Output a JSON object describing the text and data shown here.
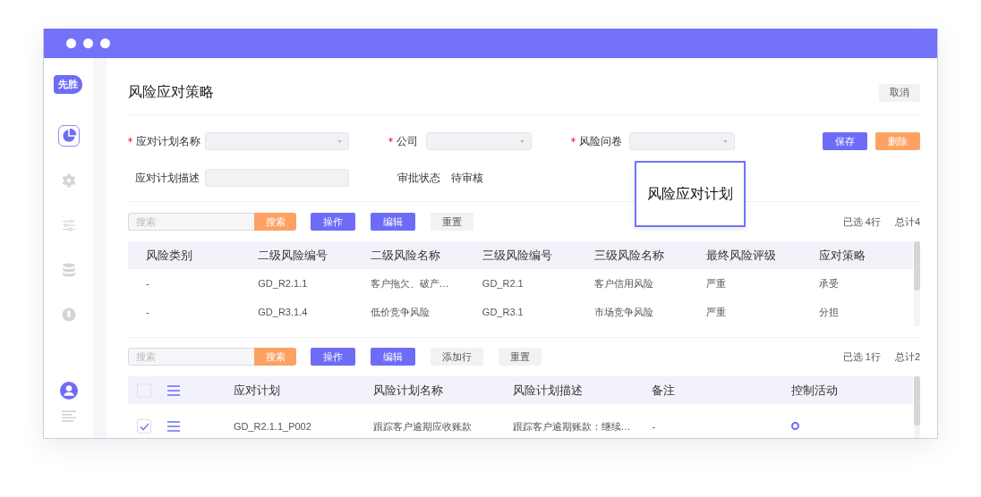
{
  "sidebar": {
    "logo": "先胜",
    "items": [
      {
        "kind": "chart",
        "selected": true
      },
      {
        "kind": "settings",
        "selected": false
      },
      {
        "kind": "sliders",
        "selected": false
      },
      {
        "kind": "database",
        "selected": false
      },
      {
        "kind": "bulb",
        "selected": false
      }
    ],
    "footer_items": [
      {
        "kind": "user"
      },
      {
        "kind": "list"
      }
    ]
  },
  "page": {
    "title": "风险应对策略",
    "cancel_button": "取消"
  },
  "form": {
    "fields": [
      {
        "label": "应对计划名称",
        "required": true,
        "kind": "select"
      },
      {
        "label": "公司",
        "required": true,
        "kind": "select"
      },
      {
        "label": "风险问卷",
        "required": true,
        "kind": "select"
      },
      {
        "label": "应对计划描述",
        "required": false,
        "kind": "text"
      }
    ],
    "status": {
      "label": "审批状态",
      "value": "待审核"
    },
    "buttons": [
      {
        "label": "保存",
        "kind": "primary"
      },
      {
        "label": "删除",
        "kind": "danger"
      }
    ]
  },
  "tooltip": "风险应对计划",
  "tables": [
    {
      "search_placeholder": "搜索",
      "search_button": "搜索",
      "buttons": [
        {
          "label": "操作",
          "kind": "primary"
        },
        {
          "label": "编辑",
          "kind": "primary"
        },
        {
          "label": "重置",
          "kind": "default"
        }
      ],
      "selected_count": "已选 4行",
      "total": "总计4",
      "kind": "plain",
      "columns": [
        "风险类别",
        "二级风险编号",
        "二级风险名称",
        "三级风险编号",
        "三级风险名称",
        "最终风险评级",
        "应对策略"
      ],
      "rows": [
        {
          "cells": [
            "-",
            "GD_R2.1.1",
            "客户拖欠、破产…",
            "GD_R2.1",
            "客户信用风险",
            "严重",
            "承受"
          ]
        },
        {
          "cells": [
            "-",
            "GD_R3.1.4",
            "低价竞争风险",
            "GD_R3.1",
            "市场竞争风险",
            "严重",
            "分担"
          ]
        }
      ]
    },
    {
      "search_placeholder": "搜索",
      "search_button": "搜索",
      "buttons": [
        {
          "label": "操作",
          "kind": "primary"
        },
        {
          "label": "编辑",
          "kind": "primary"
        },
        {
          "label": "添加行",
          "kind": "default"
        },
        {
          "label": "重置",
          "kind": "default"
        }
      ],
      "selected_count": "已选 1行",
      "total": "总计2",
      "kind": "checkable",
      "header_checked": false,
      "columns": [
        "应对计划",
        "风险计划名称",
        "风险计划描述",
        "备注",
        "控制活动"
      ],
      "rows": [
        {
          "checked": true,
          "control_activity": true,
          "cells": [
            "GD_R2.1.1_P002",
            "跟踪客户逾期应收账款",
            "跟踪客户逾期账款：继续…",
            "-"
          ]
        }
      ]
    }
  ]
}
